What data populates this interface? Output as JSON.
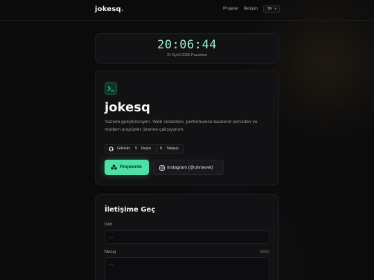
{
  "header": {
    "brand": "jokesq",
    "brand_dot": ".",
    "nav": [
      "Projeler",
      "İletişim"
    ],
    "language": "TR",
    "language_chevron": "▾"
  },
  "clock": {
    "time": "20:06:44",
    "date": "21 Eylül 2026 Pazartesi"
  },
  "profile": {
    "terminal_icon": "terminal-icon",
    "name": "jokesq",
    "bio": "Yazılım geliştiricisiyim. Web sistemleri, performanslı backend servisleri ve modern arayüzler üzerine çalışıyorum.",
    "github_label": "GitHub:",
    "repo_count": "5",
    "repo_label": "Repo",
    "follower_count": "0",
    "follower_label": "Takipçi",
    "projects_button": "Projelerim",
    "instagram_button": "Instagram (@uhmevet)"
  },
  "contact": {
    "title": "İletişime Geç",
    "name_label": "İsim",
    "name_placeholder": "...",
    "message_label": "Mesaj",
    "message_counter": "0/500",
    "message_placeholder": "..."
  },
  "colors": {
    "accent": "#4ee0a6",
    "clock": "#9ff0d1",
    "background": "#0b0b0c",
    "card": "#121214"
  }
}
